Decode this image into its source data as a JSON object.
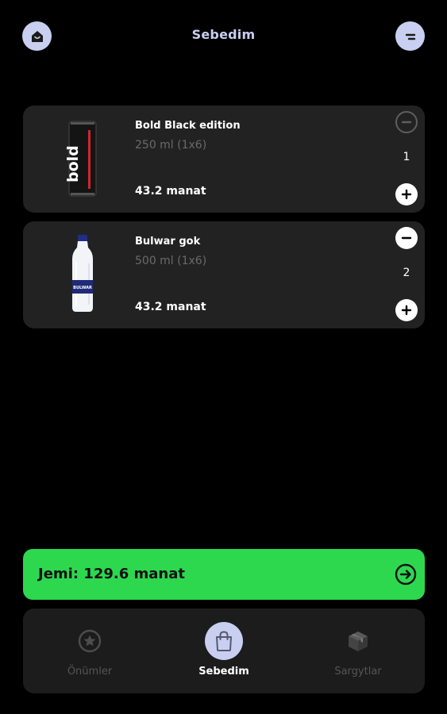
{
  "header": {
    "title": "Sebedim",
    "left_icon": "home-icon",
    "right_icon": "menu-icon"
  },
  "cart": {
    "items": [
      {
        "name": "Bold Black edition",
        "size": "250 ml (1x6)",
        "price": "43.2 manat",
        "quantity": "1",
        "image": "energy-drink-can-image",
        "image_text": "bold",
        "minus_enabled": false
      },
      {
        "name": "Bulwar gok",
        "size": "500 ml (1x6)",
        "price": "43.2 manat",
        "quantity": "2",
        "image": "water-bottle-image",
        "image_text": "BULWAR",
        "minus_enabled": true
      }
    ]
  },
  "total": {
    "label": "Jemi: 129.6 manat",
    "icon": "arrow-right-circle-icon",
    "color": "#2dd84f"
  },
  "nav": {
    "items": [
      {
        "label": "Önümler",
        "icon": "star-icon",
        "active": false
      },
      {
        "label": "Sebedim",
        "icon": "shopping-bag-icon",
        "active": true
      },
      {
        "label": "Sargytlar",
        "icon": "box-icon",
        "active": false
      }
    ]
  },
  "colors": {
    "background": "#000000",
    "card": "#222222",
    "accent": "#c9cff0",
    "green": "#2dd84f",
    "muted_text": "#6a6a6a"
  }
}
